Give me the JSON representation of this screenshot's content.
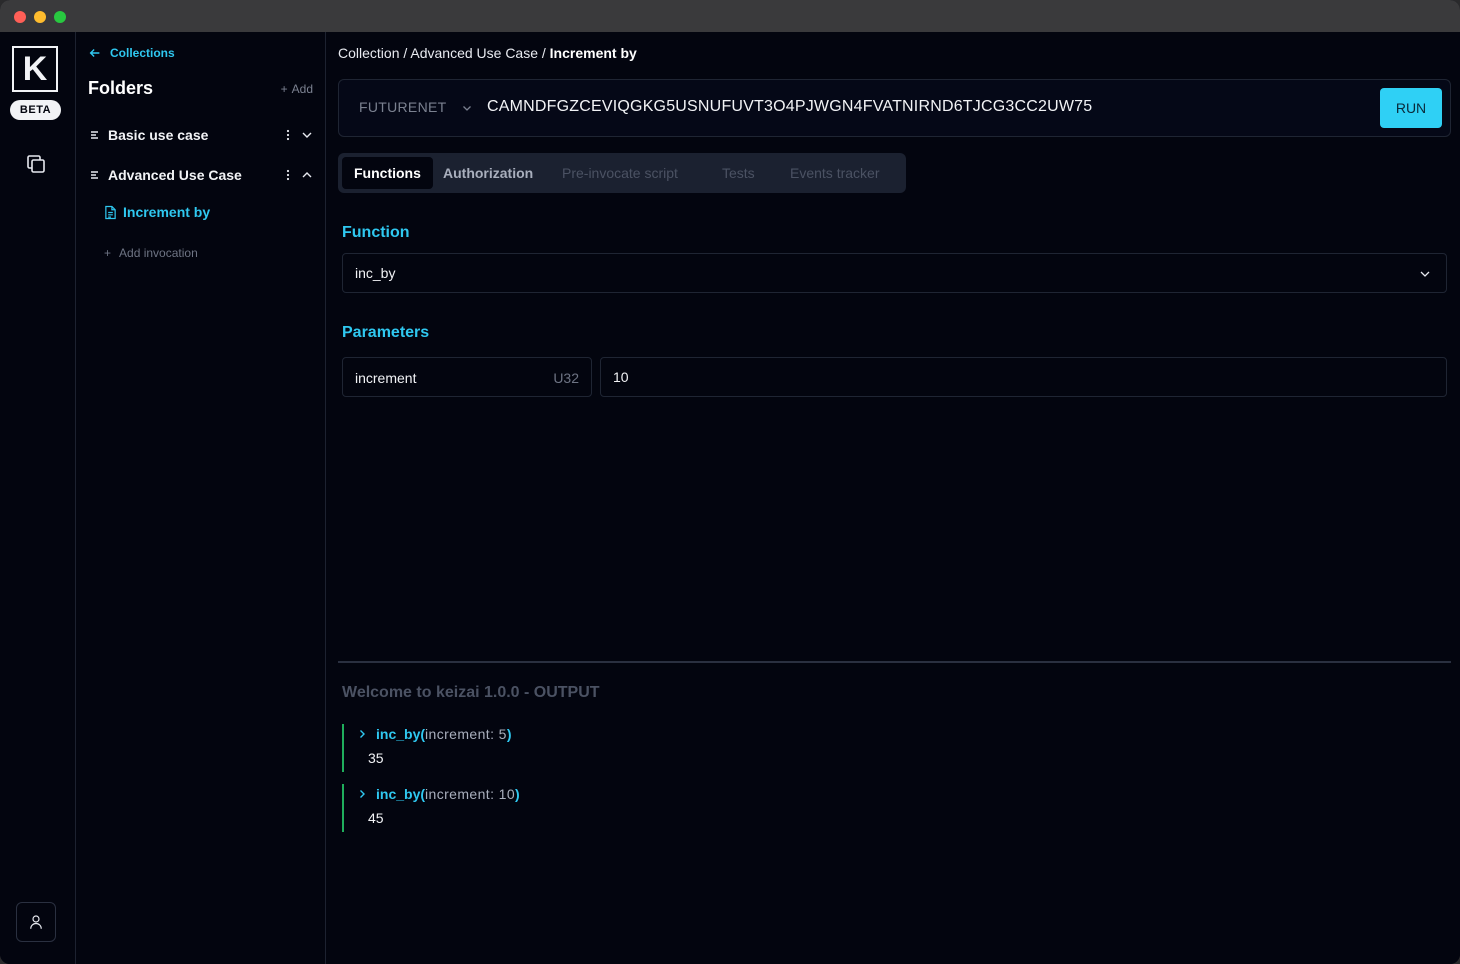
{
  "rail": {
    "logo_letter": "K",
    "beta_label": "BETA"
  },
  "sidebar": {
    "back_label": "Collections",
    "title": "Folders",
    "add_label": "Add",
    "folders": [
      {
        "label": "Basic use case",
        "expanded": false
      },
      {
        "label": "Advanced Use Case",
        "expanded": true
      }
    ],
    "invocation_label": "Increment by",
    "add_invocation_label": "Add invocation"
  },
  "breadcrumb": {
    "part1": "Collection / Advanced Use Case / ",
    "current": "Increment by"
  },
  "contract": {
    "network": "FUTURENET",
    "id": "CAMNDFGZCEVIQGKG5USNUFUVT3O4PJWGN4FVATNIRND6TJCG3CC2UW75",
    "run_label": "RUN"
  },
  "tabs": [
    "Functions",
    "Authorization",
    "Pre-invocate script",
    "Tests",
    "Events tracker"
  ],
  "function_section": {
    "title": "Function",
    "selected": "inc_by"
  },
  "parameters_section": {
    "title": "Parameters",
    "params": [
      {
        "name": "increment",
        "type": "U32",
        "value": "10"
      }
    ]
  },
  "output": {
    "title": "Welcome to keizai 1.0.0 - OUTPUT",
    "logs": [
      {
        "fn": "inc_by(",
        "args": " increment: 5 ",
        "close": ")",
        "result": "35"
      },
      {
        "fn": "inc_by(",
        "args": " increment: 10 ",
        "close": ")",
        "result": "45"
      }
    ]
  },
  "colors": {
    "accent": "#2fc8f0",
    "background": "#03050f",
    "log_border": "#1fae5c"
  }
}
